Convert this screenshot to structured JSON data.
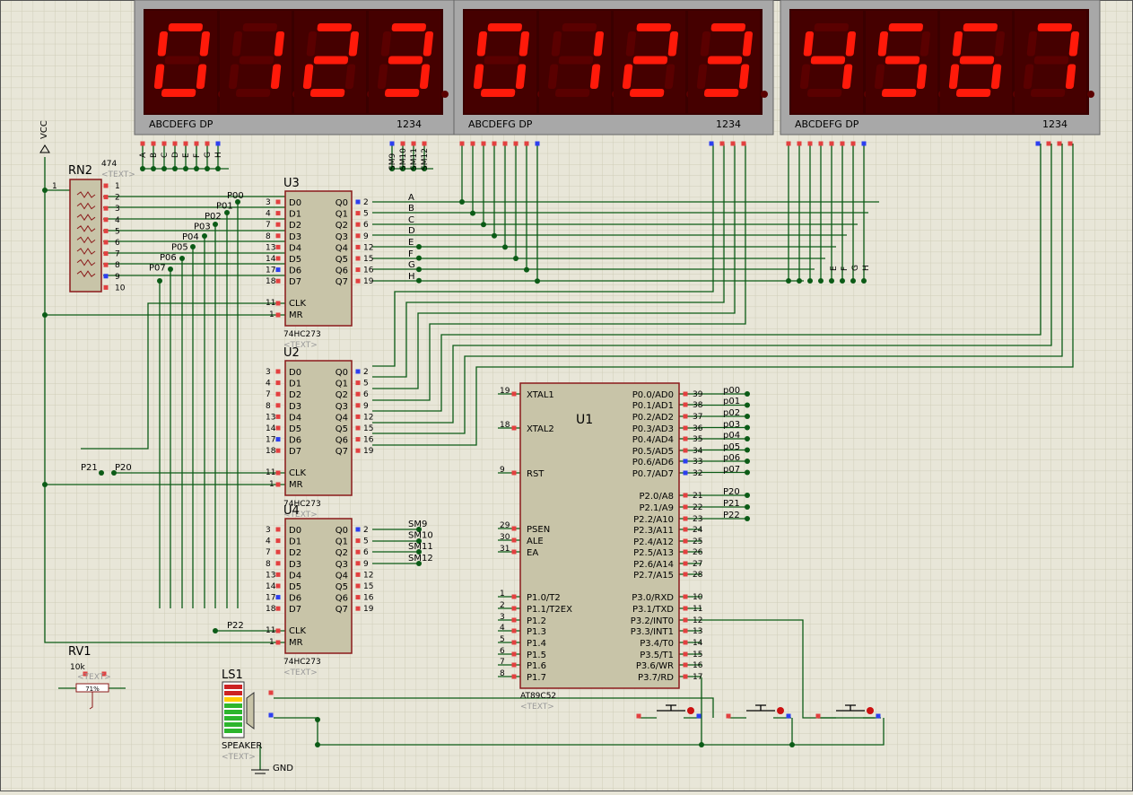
{
  "displays": [
    {
      "digits": [
        "0",
        "1",
        "2",
        "3"
      ],
      "seg_label": "ABCDEFG  DP",
      "dig_label": "1234",
      "pin_labels": [
        "A",
        "B",
        "C",
        "D",
        "E",
        "F",
        "G",
        "H"
      ],
      "com_labels": [
        "SM9",
        "SM10",
        "SM11",
        "SM12"
      ]
    },
    {
      "digits": [
        "0",
        "1",
        "2",
        "3"
      ],
      "seg_label": "ABCDEFG  DP",
      "dig_label": "1234"
    },
    {
      "digits": [
        "4",
        "5",
        "6",
        "7"
      ],
      "seg_label": "ABCDEFG  DP",
      "dig_label": "1234"
    }
  ],
  "vcc": "VCC",
  "rn2": {
    "name": "RN2",
    "value": "474",
    "text": "<TEXT>",
    "pins": [
      "1",
      "2",
      "3",
      "4",
      "5",
      "6",
      "7",
      "8",
      "9",
      "10"
    ]
  },
  "latches": [
    {
      "name": "U3",
      "type": "74HC273",
      "text": "<TEXT>",
      "in_pins": [
        "3",
        "4",
        "7",
        "8",
        "13",
        "14",
        "17",
        "18"
      ],
      "out_pins": [
        "2",
        "5",
        "6",
        "9",
        "12",
        "15",
        "16",
        "19"
      ],
      "in_labels": [
        "D0",
        "D1",
        "D2",
        "D3",
        "D4",
        "D5",
        "D6",
        "D7"
      ],
      "out_labels": [
        "Q0",
        "Q1",
        "Q2",
        "Q3",
        "Q4",
        "Q5",
        "Q6",
        "Q7"
      ],
      "clk_pin": "11",
      "mr_pin": "1",
      "clk_label": "CLK",
      "mr_label": "MR",
      "out_nets": [
        "A",
        "B",
        "C",
        "D",
        "E",
        "F",
        "G",
        "H"
      ]
    },
    {
      "name": "U2",
      "type": "74HC273",
      "text": "<TEXT>",
      "in_pins": [
        "3",
        "4",
        "7",
        "8",
        "13",
        "14",
        "17",
        "18"
      ],
      "out_pins": [
        "2",
        "5",
        "6",
        "9",
        "12",
        "15",
        "16",
        "19"
      ],
      "in_labels": [
        "D0",
        "D1",
        "D2",
        "D3",
        "D4",
        "D5",
        "D6",
        "D7"
      ],
      "out_labels": [
        "Q0",
        "Q1",
        "Q2",
        "Q3",
        "Q4",
        "Q5",
        "Q6",
        "Q7"
      ],
      "clk_pin": "11",
      "mr_pin": "1",
      "clk_label": "CLK",
      "mr_label": "MR",
      "out_nets": []
    },
    {
      "name": "U4",
      "type": "74HC273",
      "text": "<TEXT>",
      "in_pins": [
        "3",
        "4",
        "7",
        "8",
        "13",
        "14",
        "17",
        "18"
      ],
      "out_pins": [
        "2",
        "5",
        "6",
        "9",
        "12",
        "15",
        "16",
        "19"
      ],
      "in_labels": [
        "D0",
        "D1",
        "D2",
        "D3",
        "D4",
        "D5",
        "D6",
        "D7"
      ],
      "out_labels": [
        "Q0",
        "Q1",
        "Q2",
        "Q3",
        "Q4",
        "Q5",
        "Q6",
        "Q7"
      ],
      "clk_pin": "11",
      "mr_pin": "1",
      "clk_label": "CLK",
      "mr_label": "MR",
      "out_nets": [
        "SM9",
        "SM10",
        "SM11",
        "SM12"
      ]
    }
  ],
  "bus_labels": [
    "P00",
    "P01",
    "P02",
    "P03",
    "P04",
    "P05",
    "P06",
    "P07"
  ],
  "clk_labels": [
    "P21",
    "P20",
    "P22"
  ],
  "right_bus_labels": [
    "E",
    "F",
    "G",
    "H"
  ],
  "u1": {
    "name": "U1",
    "type": "AT89C52",
    "text": "<TEXT>",
    "left_pins": [
      {
        "num": "19",
        "label": "XTAL1"
      },
      {
        "num": "18",
        "label": "XTAL2"
      },
      {
        "num": "9",
        "label": "RST"
      },
      {
        "num": "29",
        "label": "PSEN"
      },
      {
        "num": "30",
        "label": "ALE"
      },
      {
        "num": "31",
        "label": "EA"
      },
      {
        "num": "1",
        "label": "P1.0/T2"
      },
      {
        "num": "2",
        "label": "P1.1/T2EX"
      },
      {
        "num": "3",
        "label": "P1.2"
      },
      {
        "num": "4",
        "label": "P1.3"
      },
      {
        "num": "5",
        "label": "P1.4"
      },
      {
        "num": "6",
        "label": "P1.5"
      },
      {
        "num": "7",
        "label": "P1.6"
      },
      {
        "num": "8",
        "label": "P1.7"
      }
    ],
    "right_pins": [
      {
        "num": "39",
        "label": "P0.0/AD0",
        "net": "p00"
      },
      {
        "num": "38",
        "label": "P0.1/AD1",
        "net": "p01"
      },
      {
        "num": "37",
        "label": "P0.2/AD2",
        "net": "p02"
      },
      {
        "num": "36",
        "label": "P0.3/AD3",
        "net": "p03"
      },
      {
        "num": "35",
        "label": "P0.4/AD4",
        "net": "p04"
      },
      {
        "num": "34",
        "label": "P0.5/AD5",
        "net": "p05"
      },
      {
        "num": "33",
        "label": "P0.6/AD6",
        "net": "p06"
      },
      {
        "num": "32",
        "label": "P0.7/AD7",
        "net": "p07"
      },
      {
        "num": "21",
        "label": "P2.0/A8",
        "net": "P20"
      },
      {
        "num": "22",
        "label": "P2.1/A9",
        "net": "P21"
      },
      {
        "num": "23",
        "label": "P2.2/A10",
        "net": "P22"
      },
      {
        "num": "24",
        "label": "P2.3/A11",
        "net": ""
      },
      {
        "num": "25",
        "label": "P2.4/A12",
        "net": ""
      },
      {
        "num": "26",
        "label": "P2.5/A13",
        "net": ""
      },
      {
        "num": "27",
        "label": "P2.6/A14",
        "net": ""
      },
      {
        "num": "28",
        "label": "P2.7/A15",
        "net": ""
      },
      {
        "num": "10",
        "label": "P3.0/RXD",
        "net": ""
      },
      {
        "num": "11",
        "label": "P3.1/TXD",
        "net": ""
      },
      {
        "num": "12",
        "label": "P3.2/INT0",
        "net": ""
      },
      {
        "num": "13",
        "label": "P3.3/INT1",
        "net": ""
      },
      {
        "num": "14",
        "label": "P3.4/T0",
        "net": ""
      },
      {
        "num": "15",
        "label": "P3.5/T1",
        "net": ""
      },
      {
        "num": "16",
        "label": "P3.6/WR",
        "net": ""
      },
      {
        "num": "17",
        "label": "P3.7/RD",
        "net": ""
      }
    ]
  },
  "rv1": {
    "name": "RV1",
    "value": "10k",
    "text": "<TEXT>",
    "percent": "71%"
  },
  "ls1": {
    "name": "LS1",
    "type": "SPEAKER",
    "text": "<TEXT>"
  },
  "gnd": "GND",
  "colors": {
    "background": "#e8e6d8",
    "grid": "#cfcdb8",
    "wire": "#0b5b16",
    "body": "#c8c4a8",
    "border": "#8b1a1a",
    "seg_on": "#ff1a0a",
    "seg_off": "#5a0000",
    "display_bg": "#3a0000",
    "display_frame": "#a8a8a8",
    "pin_red": "#e34040",
    "pin_blue": "#2d3ff0"
  }
}
